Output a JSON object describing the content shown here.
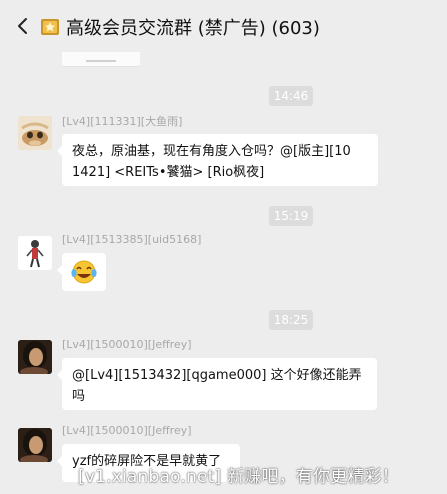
{
  "header": {
    "title": "高级会员交流群 (禁广告) (603)"
  },
  "messages": [
    {
      "time": "14:46",
      "sender": "[Lv4][111331][大鱼雨]",
      "text": "夜总，原油基，现在有角度入仓吗？@[版主][10\n1421] <REITs•饕猫> [Rio枫夜]"
    },
    {
      "time": "15:19",
      "sender": "[Lv4][1513385][uid5168]",
      "emoji": "laughing-crying-emoji"
    },
    {
      "time": "18:25",
      "sender": "[Lv4][1500010][Jeffrey]",
      "text": "@[Lv4][1513432][qgame000] 这个好像还能弄\n吗"
    },
    {
      "sender": "[Lv4][1500010][Jeffrey]",
      "text": "yzf的碎屏险不是早就黄了"
    }
  ],
  "watermark": "[v1.xianbao.net] 新赚吧，有你更精彩！",
  "colors": {
    "background": "#ededed",
    "bubble": "#ffffff",
    "time_badge": "#dcdcdc",
    "sender_text": "#a8a8a8"
  }
}
